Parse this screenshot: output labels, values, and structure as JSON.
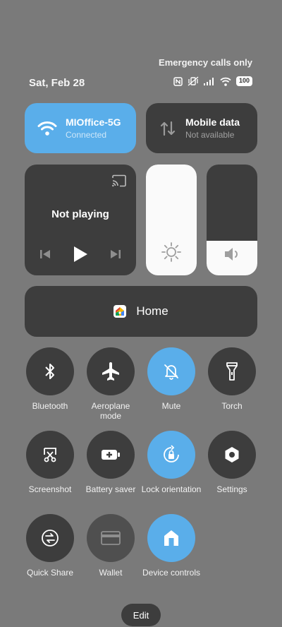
{
  "status_bar": {
    "emergency_text": "Emergency calls only",
    "date": "Sat, Feb 28",
    "battery_level": "100"
  },
  "tiles": {
    "wifi": {
      "title": "MIOffice-5G",
      "subtitle": "Connected"
    },
    "mobile_data": {
      "title": "Mobile data",
      "subtitle": "Not available"
    }
  },
  "media": {
    "title": "Not playing"
  },
  "sliders": {
    "brightness_level": 1.0,
    "volume_level": 0.31
  },
  "home": {
    "label": "Home"
  },
  "quick_settings": [
    {
      "id": "bluetooth",
      "label": "Bluetooth",
      "icon": "bluetooth-icon",
      "state": "off"
    },
    {
      "id": "aeroplane",
      "label": "Aeroplane mode",
      "icon": "airplane-icon",
      "state": "off"
    },
    {
      "id": "mute",
      "label": "Mute",
      "icon": "bell-off-icon",
      "state": "on"
    },
    {
      "id": "torch",
      "label": "Torch",
      "icon": "flashlight-icon",
      "state": "off"
    },
    {
      "id": "screenshot",
      "label": "Screenshot",
      "icon": "scissors-icon",
      "state": "off"
    },
    {
      "id": "battery_saver",
      "label": "Battery saver",
      "icon": "battery-plus-icon",
      "state": "off"
    },
    {
      "id": "lock_orientation",
      "label": "Lock orientation",
      "icon": "rotation-lock-icon",
      "state": "on"
    },
    {
      "id": "settings",
      "label": "Settings",
      "icon": "gear-icon",
      "state": "off"
    },
    {
      "id": "quick_share",
      "label": "Quick Share",
      "icon": "share-circle-icon",
      "state": "off"
    },
    {
      "id": "wallet",
      "label": "Wallet",
      "icon": "card-icon",
      "state": "disabled"
    },
    {
      "id": "device_controls",
      "label": "Device controls",
      "icon": "home-icon",
      "state": "on"
    }
  ],
  "edit_label": "Edit",
  "colors": {
    "accent": "#5aaeea",
    "tile": "#3d3d3d",
    "background": "#7a7a7a"
  }
}
